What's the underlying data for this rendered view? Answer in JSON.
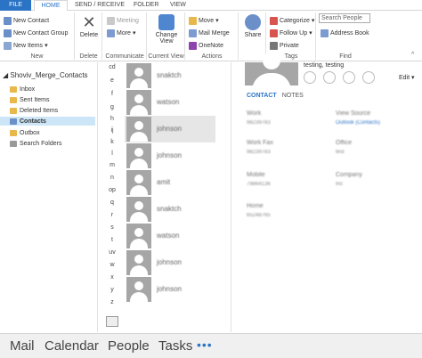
{
  "tabs": {
    "file": "FILE",
    "home": "HOME",
    "send_receive": "SEND / RECEIVE",
    "folder": "FOLDER",
    "view": "VIEW"
  },
  "ribbon": {
    "new_group": {
      "new_contact": "New Contact",
      "new_contact_group": "New Contact Group",
      "new_items": "New Items",
      "label": "New"
    },
    "delete_group": {
      "delete": "Delete",
      "label": "Delete"
    },
    "communicate_group": {
      "meeting": "Meeting",
      "more": "More",
      "label": "Communicate"
    },
    "current_view_group": {
      "change_view": "Change View",
      "label": "Current View"
    },
    "actions_group": {
      "move": "Move",
      "mail_merge": "Mail Merge",
      "onenote": "OneNote",
      "label": "Actions"
    },
    "share_group": {
      "share": "Share"
    },
    "tags_group": {
      "categorize": "Categorize",
      "follow_up": "Follow Up",
      "private": "Private",
      "label": "Tags"
    },
    "find_group": {
      "search_people": "Search People",
      "address_book": "Address Book",
      "label": "Find"
    }
  },
  "folders": {
    "root": "Shoviv_Merge_Contacts",
    "items": [
      {
        "label": "Inbox"
      },
      {
        "label": "Sent Items"
      },
      {
        "label": "Deleted Items"
      },
      {
        "label": "Contacts",
        "selected": true
      },
      {
        "label": "Outbox"
      },
      {
        "label": "Search Folders"
      }
    ]
  },
  "index_letters": [
    "cd",
    "e",
    "f",
    "g",
    "h",
    "ij",
    "k",
    "l",
    "m",
    "n",
    "op",
    "q",
    "r",
    "s",
    "t",
    "uv",
    "w",
    "x",
    "y",
    "z"
  ],
  "contacts": [
    {
      "name": "snaktch"
    },
    {
      "name": "watson"
    },
    {
      "name": "johnson",
      "selected": true
    },
    {
      "name": "johnson"
    },
    {
      "name": "amit"
    },
    {
      "name": "snaktch"
    },
    {
      "name": "watson"
    },
    {
      "name": "johnson"
    },
    {
      "name": "johnson"
    }
  ],
  "reading_pane": {
    "name": "testing, testing",
    "edit": "Edit",
    "tab_contact": "CONTACT",
    "tab_notes": "NOTES",
    "fields": {
      "work_label": "Work",
      "work_value": "98239783",
      "view_source_label": "View Source",
      "view_source_value": "Outlook (Contacts)",
      "work_fax_label": "Work Fax",
      "work_fax_value": "98239783",
      "office_label": "Office",
      "office_value": "test",
      "mobile_label": "Mobile",
      "mobile_value": "79864136",
      "company_label": "Company",
      "company_value": "Inc",
      "home_label": "Home",
      "home_value": "65248765"
    }
  },
  "bottom_nav": {
    "mail": "Mail",
    "calendar": "Calendar",
    "people": "People",
    "tasks": "Tasks",
    "more": "•••"
  },
  "colors": {
    "accent": "#2b74c5",
    "selected_folder": "#cde6f7",
    "avatar_gray": "#a6a6a6"
  }
}
